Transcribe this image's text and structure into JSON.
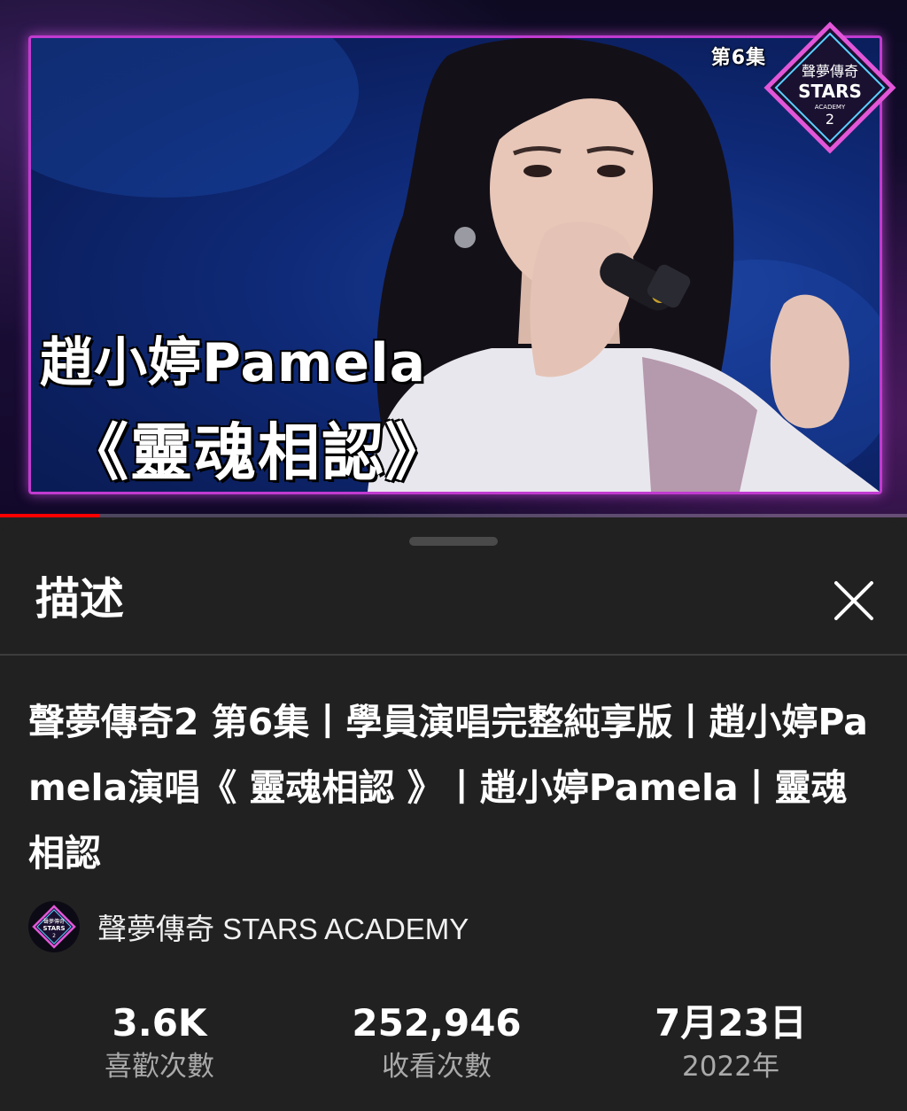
{
  "video": {
    "thumbnail": {
      "episode_label": "第6集",
      "name_text": "趙小婷Pamela",
      "song_text": "《靈魂相認》",
      "logo": {
        "line1": "聲夢傳奇",
        "line2": "STARS",
        "line3": "ACADEMY",
        "line4": "2"
      }
    },
    "progress_fraction": 0.11,
    "colors": {
      "progress": "#ff0000",
      "frame_border": "#c13bd0"
    }
  },
  "sheet": {
    "title": "描述",
    "close_icon": "close-icon",
    "video_title": "聲夢傳奇2 第6集丨學員演唱完整純享版丨趙小婷Pamela演唱《 靈魂相認 》丨趙小婷Pamela丨靈魂相認",
    "channel": {
      "name": "聲夢傳奇 STARS ACADEMY",
      "avatar_text": {
        "line1": "聲夢傳奇",
        "line2": "STARS",
        "line3": "2"
      }
    },
    "stats": [
      {
        "value": "3.6K",
        "label": "喜歡次數"
      },
      {
        "value": "252,946",
        "label": "收看次數"
      },
      {
        "value": "7月23日",
        "label": "2022年"
      }
    ]
  }
}
